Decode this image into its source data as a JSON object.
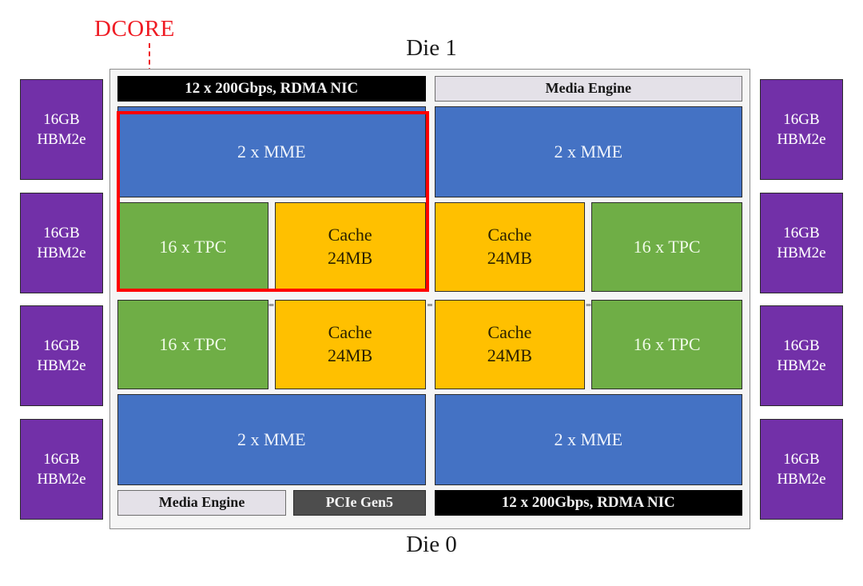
{
  "annotation": {
    "dcore_label": "DCORE"
  },
  "dies": {
    "top_caption": "Die 1",
    "bottom_caption": "Die 0"
  },
  "memory": {
    "left_stacks": [
      {
        "capacity": "16GB",
        "type": "HBM2e"
      },
      {
        "capacity": "16GB",
        "type": "HBM2e"
      },
      {
        "capacity": "16GB",
        "type": "HBM2e"
      },
      {
        "capacity": "16GB",
        "type": "HBM2e"
      }
    ],
    "right_stacks": [
      {
        "capacity": "16GB",
        "type": "HBM2e"
      },
      {
        "capacity": "16GB",
        "type": "HBM2e"
      },
      {
        "capacity": "16GB",
        "type": "HBM2e"
      },
      {
        "capacity": "16GB",
        "type": "HBM2e"
      }
    ]
  },
  "die1": {
    "left": {
      "nic": "12 x 200Gbps, RDMA NIC",
      "mme": "2 x MME",
      "tpc": "16 x TPC",
      "cache_line1": "Cache",
      "cache_line2": "24MB"
    },
    "right": {
      "media_engine": "Media Engine",
      "mme": "2 x MME",
      "cache_line1": "Cache",
      "cache_line2": "24MB",
      "tpc": "16 x TPC"
    }
  },
  "die0": {
    "left": {
      "tpc": "16 x TPC",
      "cache_line1": "Cache",
      "cache_line2": "24MB",
      "mme": "2 x MME",
      "media_engine": "Media Engine",
      "pcie": "PCIe Gen5"
    },
    "right": {
      "cache_line1": "Cache",
      "cache_line2": "24MB",
      "tpc": "16 x TPC",
      "mme": "2 x MME",
      "nic": "12 x 200Gbps, RDMA NIC"
    }
  },
  "colors": {
    "mme": "#4472C4",
    "tpc": "#6FAE46",
    "cache": "#FFC000",
    "hbm": "#7230A8",
    "nic": "#000000",
    "media_engine": "#E4E1E8",
    "pcie": "#4D4D4D",
    "dcore_highlight": "#FF0000",
    "package_background": "#F5F5F5"
  }
}
